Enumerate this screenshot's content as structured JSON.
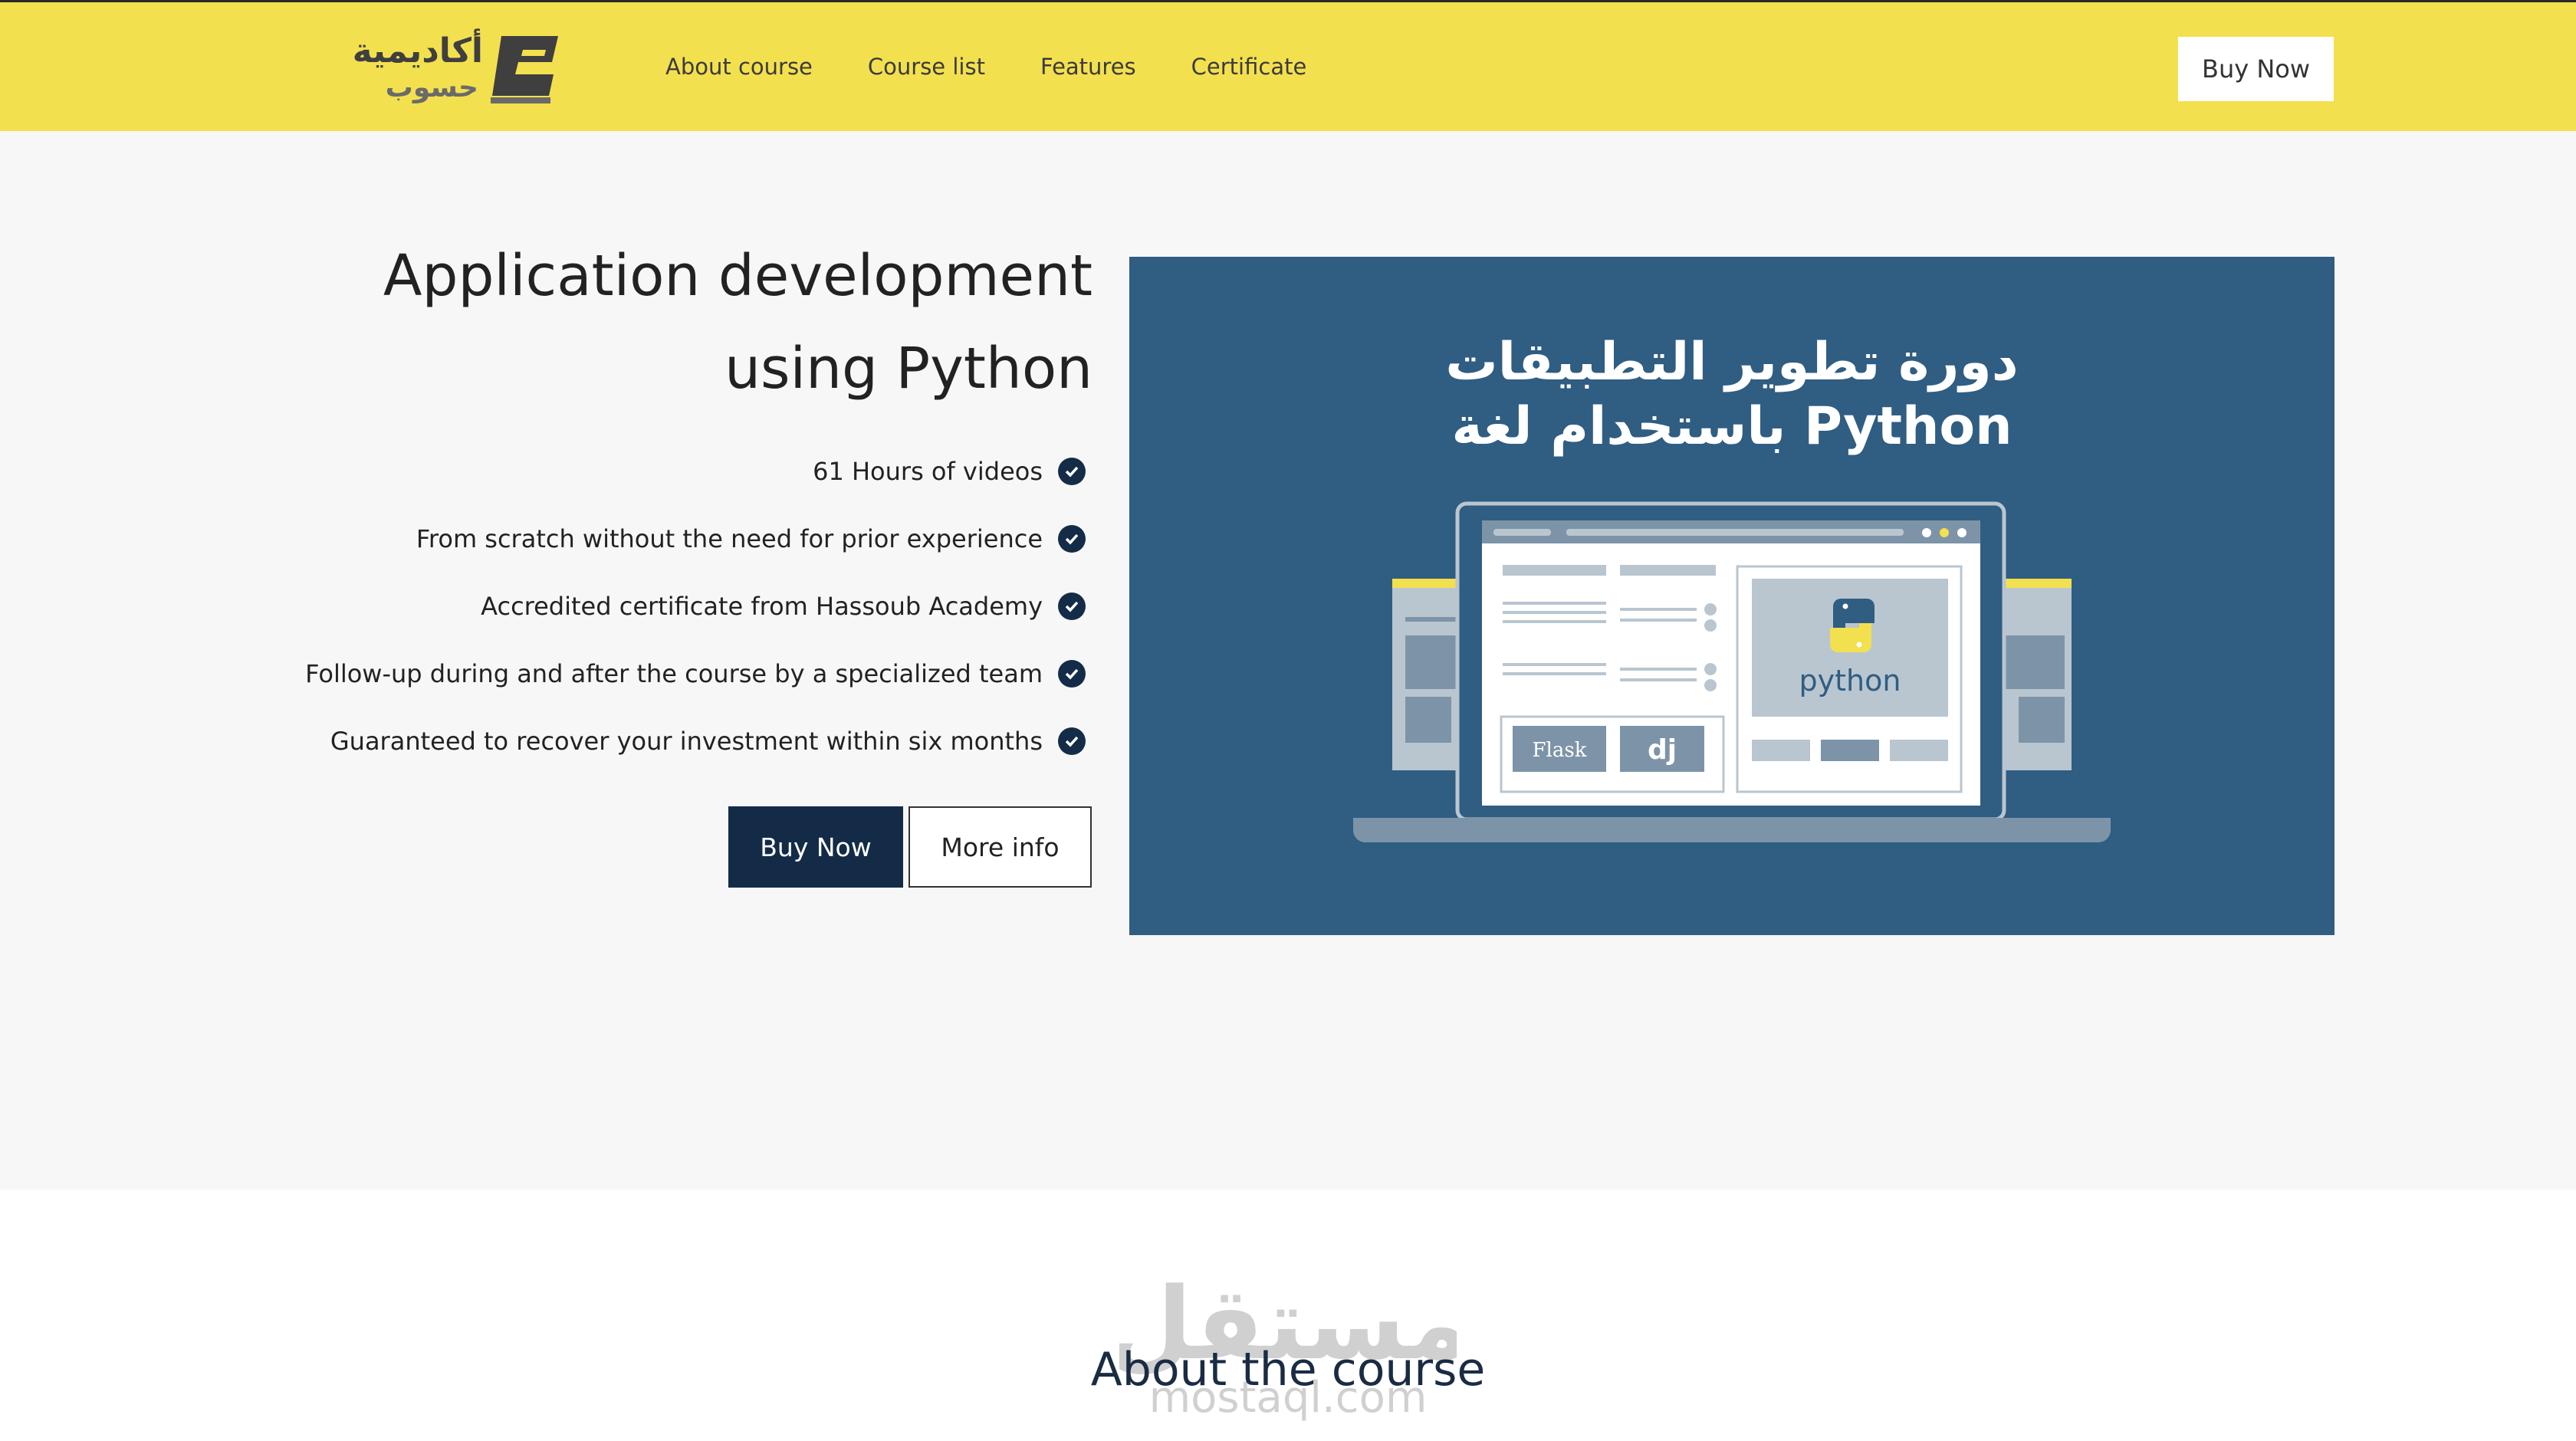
{
  "header": {
    "logo_line1": "أكاديمية",
    "logo_line2": "حسوب",
    "nav": [
      "About course",
      "Course list",
      "Features",
      "Certificate"
    ],
    "buy_label": "Buy Now"
  },
  "hero": {
    "title": "Application development using Python",
    "features": [
      "61 Hours of videos",
      "From scratch without the need for prior experience",
      "Accredited certificate from Hassoub Academy",
      "Follow-up during and after the course by a specialized team",
      "Guaranteed to recover your investment within six months"
    ],
    "buy_label": "Buy Now",
    "more_label": "More info"
  },
  "banner": {
    "title_line1": "دورة تطوير التطبيقات",
    "title_line2": "باستخدام لغة Python",
    "python_label": "python",
    "flask_label": "Flask",
    "django_label": "dj"
  },
  "about": {
    "title": "About the course",
    "watermark": "مستقل",
    "watermark_sub": "mostaql.com"
  },
  "colors": {
    "navbar": "#f3e04e",
    "banner": "#305d82",
    "primary": "#132b46"
  },
  "icons": [
    "check-circle-icon",
    "academy-logo-icon",
    "python-logo-icon"
  ]
}
